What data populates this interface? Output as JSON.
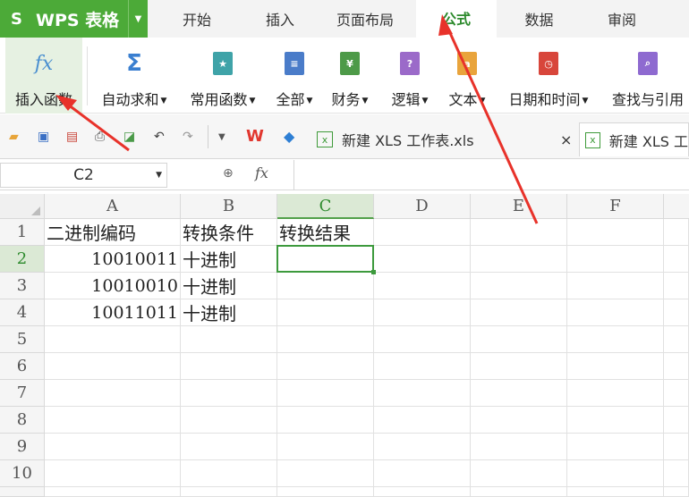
{
  "app": {
    "logo": "S",
    "name": "WPS 表格"
  },
  "menu_tabs": [
    "开始",
    "插入",
    "页面布局",
    "公式",
    "数据",
    "审阅"
  ],
  "active_tab": "公式",
  "ribbon": [
    {
      "label": "插入函数",
      "icon": "fx-icon",
      "dropdown": false
    },
    {
      "label": "自动求和",
      "icon": "sigma-icon",
      "dropdown": true
    },
    {
      "label": "常用函数",
      "icon": "star-book-icon",
      "dropdown": true
    },
    {
      "label": "全部",
      "icon": "list-book-icon",
      "dropdown": true
    },
    {
      "label": "财务",
      "icon": "money-book-icon",
      "dropdown": true
    },
    {
      "label": "逻辑",
      "icon": "question-book-icon",
      "dropdown": true
    },
    {
      "label": "文本",
      "icon": "text-book-icon",
      "dropdown": true
    },
    {
      "label": "日期和时间",
      "icon": "clock-book-icon",
      "dropdown": true
    },
    {
      "label": "查找与引用",
      "icon": "search-book-icon",
      "dropdown": false
    }
  ],
  "doc_tabs": [
    "新建 XLS 工作表.xls",
    "新建 XLS 工"
  ],
  "name_box": "C2",
  "fx_label": "fx",
  "columns": [
    "A",
    "B",
    "C",
    "D",
    "E",
    "F"
  ],
  "rows": [
    "1",
    "2",
    "3",
    "4",
    "5",
    "6",
    "7",
    "8",
    "9",
    "10"
  ],
  "cells": {
    "A1": "二进制编码",
    "B1": "转换条件",
    "C1": "转换结果",
    "A2": "10010011",
    "B2": "十进制",
    "A3": "10010010",
    "B3": "十进制",
    "A4": "10011011",
    "B4": "十进制"
  },
  "colors": {
    "accent": "#4caa38",
    "arrow": "#e8322a",
    "selected": "#3d9a3d"
  }
}
